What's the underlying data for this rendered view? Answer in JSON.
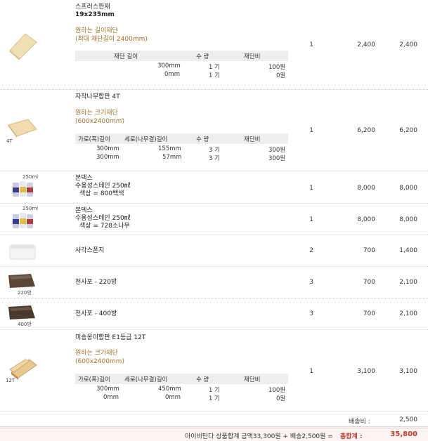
{
  "items": [
    {
      "name_line1": "스프러스판재",
      "name_line2": "19x235mm",
      "option_title": "원하는 길이재단",
      "option_note": "(최대 재단길이 2400mm)",
      "sub_headers": [
        "재단 길이",
        "수 량",
        "재단비"
      ],
      "sub_rows": [
        [
          "300mm",
          "1 기",
          "100원"
        ],
        [
          "0mm",
          "1 기",
          "0원"
        ]
      ],
      "qty": "1",
      "price": "2,400",
      "total": "2,400"
    },
    {
      "name_line1": "자작나무합판 4T",
      "option_title": "원하는 크기재단",
      "option_note": "(600x2400mm)",
      "thumb_label": "4T",
      "sub_headers": [
        "가로(폭)길이",
        "세로(나무결)길이",
        "수 량",
        "재단비"
      ],
      "sub_rows": [
        [
          "300mm",
          "155mm",
          "3 기",
          "300원"
        ],
        [
          "300mm",
          "57mm",
          "3 기",
          "300원"
        ]
      ],
      "qty": "1",
      "price": "6,200",
      "total": "6,200"
    },
    {
      "name_line1": "본덱스",
      "name_line2": "수용성스테인 250㎖",
      "name_line3": "색상 = 800백색",
      "thumb_label": "250ml",
      "qty": "1",
      "price": "8,000",
      "total": "8,000"
    },
    {
      "name_line1": "본덱스",
      "name_line2": "수용성스테인 250㎖",
      "name_line3": "색상 = 728소나무",
      "thumb_label": "250ml",
      "qty": "1",
      "price": "8,000",
      "total": "8,000"
    },
    {
      "name_line1": "사각스폰지",
      "qty": "2",
      "price": "700",
      "total": "1,400"
    },
    {
      "name_line1": "천사포 - 220방",
      "thumb_label": "220방",
      "qty": "3",
      "price": "700",
      "total": "2,100"
    },
    {
      "name_line1": "천사포 - 400방",
      "thumb_label": "400방",
      "qty": "3",
      "price": "700",
      "total": "2,100"
    },
    {
      "name_line1": "미송옹이합판 E1등급 12T",
      "option_title": "원하는 크기재단",
      "option_note": "(600x2400mm)",
      "thumb_label": "12T",
      "sub_headers": [
        "가로(폭)길이",
        "세로(나무결)길이",
        "수 량",
        "재단비"
      ],
      "sub_rows": [
        [
          "300mm",
          "450mm",
          "1 기",
          "100원"
        ],
        [
          "0mm",
          "0mm",
          "1 기",
          "0원"
        ]
      ],
      "qty": "1",
      "price": "3,100",
      "total": "3,100"
    }
  ],
  "shipping": {
    "label": "배송비 :",
    "value": "2,500"
  },
  "summary": {
    "text": "아이비탄다 상품합계 금액33,300원 + 배송2,500원 =",
    "total_label": "총합계 :",
    "total_value": "35,800"
  },
  "colors": {
    "option_text": "#a0702a",
    "total_value": "#c0392b",
    "footer_bg": "#fbf4f3"
  }
}
